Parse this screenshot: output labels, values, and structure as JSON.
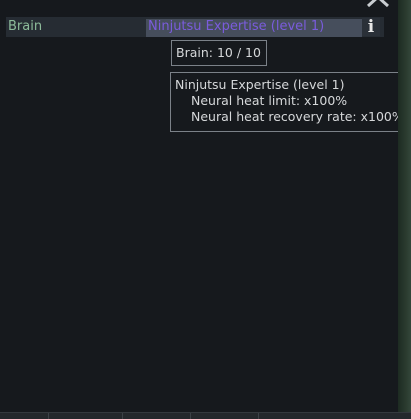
{
  "stat_row": {
    "label": "Brain",
    "value": "Ninjutsu Expertise (level 1)"
  },
  "info_button": {
    "glyph": "i"
  },
  "tooltip_value": {
    "text": "Brain:  10 / 10"
  },
  "tooltip_detail": {
    "title": "Ninjutsu Expertise (level 1)",
    "lines": [
      "Neural heat limit: x100%",
      "Neural heat recovery rate: x100%"
    ]
  },
  "colors": {
    "label": "#8dbb9a",
    "value_text": "#7a5cdc",
    "value_bg": "#464e5c",
    "background": "#16191d"
  },
  "icons": {
    "collapse": "chevron-up-icon",
    "info": "info-icon"
  }
}
